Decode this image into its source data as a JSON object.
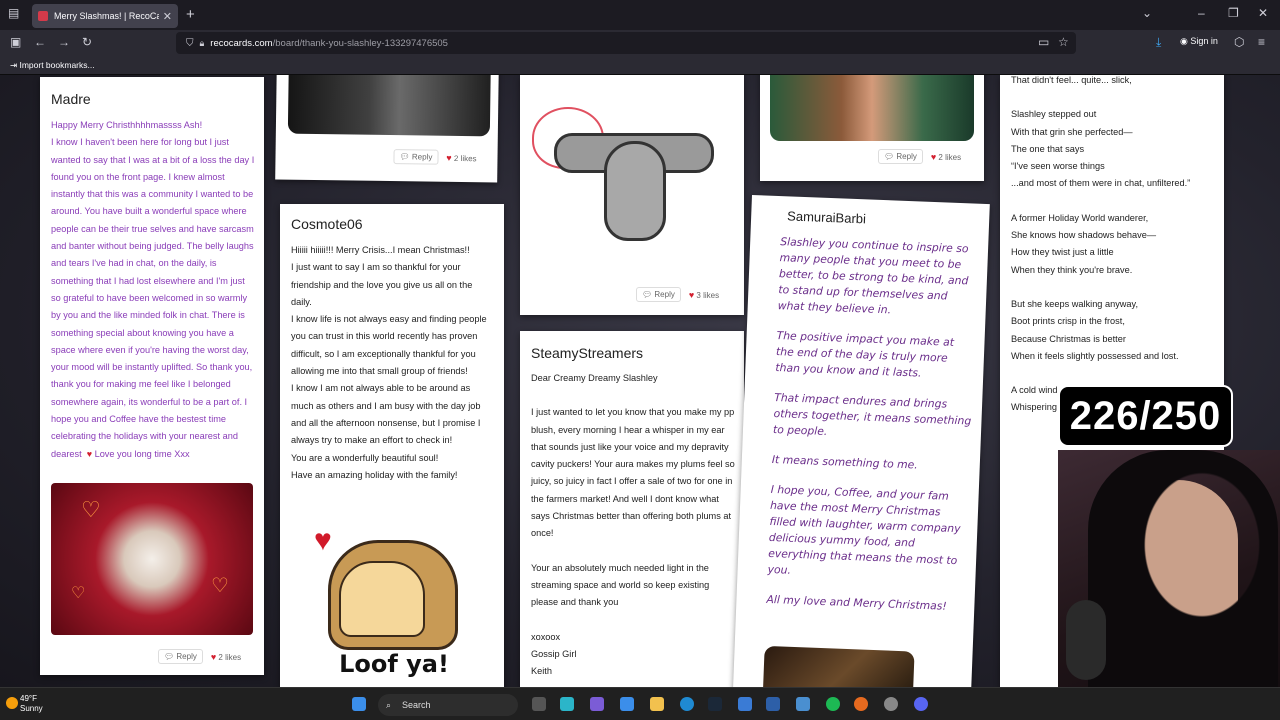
{
  "browser": {
    "tab_title": "Merry Slashmas! | RecoCards.co",
    "url_host": "recocards.com",
    "url_path": "/board/thank-you-slashley-133297476505",
    "bookmarks_label": "Import bookmarks...",
    "sign_in": "Sign in"
  },
  "cards": {
    "madre": {
      "name": "Madre",
      "greeting": "Happy Merry Christhhhhmassss Ash!",
      "body": "I know I haven't been here for long but I just wanted to say that I was at a bit of a loss the day I found you on the front page. I knew almost instantly that this was a community I wanted to be around. You have built a wonderful space where people can be their true selves and have sarcasm and banter without being judged. The belly laughs and tears I've had in chat, on the daily, is something that I had lost elsewhere and I'm just so grateful to have been welcomed in so warmly by you and the like minded folk in chat. There is something special about knowing you have a space where even if you're having the worst day, your mood will be instantly uplifted. So thank you, thank you for making me feel like I belonged somewhere again, its wonderful to be a part of. I hope you and Coffee have the bestest time celebrating the holidays with your nearest and dearest",
      "signoff": "Love you long time Xxx",
      "reply": "Reply",
      "likes": "2 likes"
    },
    "top_left_photo": {
      "reply": "Reply",
      "likes": "2 likes"
    },
    "cosmote": {
      "name": "Cosmote06",
      "lines": [
        "Hiiiii hiiiii!!! Merry Crisis...I mean Christmas!!",
        "I just want to say I am so thankful for your friendship and the love you give us all on the daily.",
        "I know life is not always easy and finding people you can trust in this world recently has proven difficult, so I am exceptionally thankful for you allowing me into that small group of friends!",
        "I know I am not always able to be around as much as others and I am busy with the day job and all the afternoon nonsense, but I promise I always try to make an effort to check in!",
        "You are a wonderfully beautiful soul!",
        "Have an amazing holiday with the family!"
      ],
      "sticker_text": "Loof ya!"
    },
    "cat_sticker": {
      "reply": "Reply",
      "likes": "3 likes"
    },
    "steamy": {
      "name": "SteamyStreamers",
      "salutation": "Dear Creamy Dreamy Slashley",
      "p1": "I just wanted to let you know that you make my pp blush, every morning I hear a whisper in my ear that sounds just like your voice and my depravity cavity puckers! Your aura makes my plums feel so juicy, so juicy in fact I offer a sale of two for one in the farmers market! And well I dont know what says Christmas better than offering both plums at once!",
      "p2": "Your an absolutely much needed light in the streaming space and world so keep existing please and thank you",
      "sign1": "xoxoox",
      "sign2": "Gossip Girl",
      "sign3": "Keith"
    },
    "top_right_photo": {
      "reply": "Reply",
      "likes": "2 likes"
    },
    "samurai": {
      "name": "SamuraiBarbi",
      "p1": "Slashley you continue to inspire so many people that you meet to be better, to be strong to be kind, and to stand up for themselves and what they believe in.",
      "p2": "The positive impact you make at the end of the day is truly more than you know and it lasts.",
      "p3": "That impact endures and brings others together, it means something to people.",
      "p4": "It means something to me.",
      "p5": "I hope you, Coffee, and your fam have the most Merry Christmas filled with laughter, warm company delicious yummy food, and everything that means the most to you.",
      "p6": "All my love and Merry Christmas!"
    },
    "poem": {
      "l1": "That didn't feel... quite... slick,",
      "l2": "Slashley stepped out",
      "l3": "With that grin she perfected—",
      "l4": "The one that says",
      "l5": "“I've seen worse things",
      "l6": "...and most of them were in chat, unfiltered.”",
      "l7": "A former Holiday World wanderer,",
      "l8": "She knows how shadows behave—",
      "l9": "How they twist just a little",
      "l10": "When they think you're brave.",
      "l11": "But she keeps walking anyway,",
      "l12": "Boot prints crisp in the frost,",
      "l13": "Because Christmas is better",
      "l14": "When it feels slightly possessed and lost.",
      "l15": "A cold wind",
      "l16": "Whispering"
    }
  },
  "overlay": {
    "counter": "226/250"
  },
  "taskbar": {
    "temp": "49°F",
    "condition": "Sunny",
    "search": "Search"
  }
}
